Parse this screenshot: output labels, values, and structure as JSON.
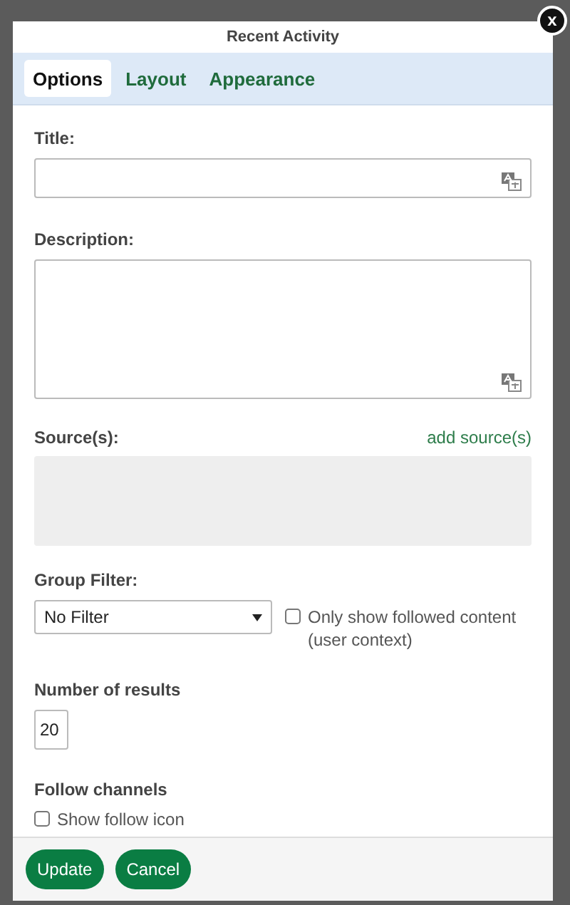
{
  "dialog": {
    "title": "Recent Activity",
    "close": "x"
  },
  "tabs": [
    {
      "label": "Options",
      "selected": true
    },
    {
      "label": "Layout",
      "selected": false
    },
    {
      "label": "Appearance",
      "selected": false
    }
  ],
  "title_field": {
    "label": "Title:"
  },
  "description_field": {
    "label": "Description:"
  },
  "sources": {
    "label": "Source(s):",
    "link": "add source(s)"
  },
  "group_filter": {
    "label": "Group Filter:",
    "value": "No Filter",
    "followed_only": {
      "label": "Only show followed content (user context)",
      "checked": false
    }
  },
  "results": {
    "label": "Number of results",
    "value": "20"
  },
  "follow_channels": {
    "label": "Follow channels",
    "option": {
      "label": "Show follow icon",
      "checked": false
    }
  },
  "buttons": [
    "Update",
    "Cancel"
  ]
}
